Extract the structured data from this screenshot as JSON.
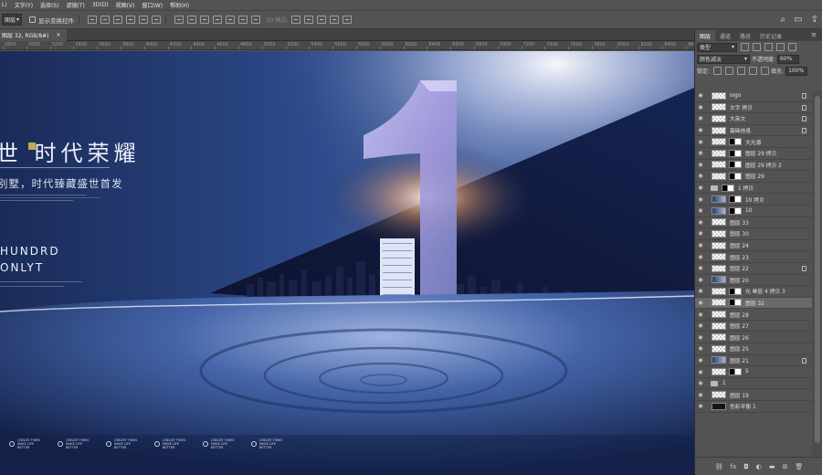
{
  "menubar": [
    "L)",
    "文字(Y)",
    "选择(S)",
    "滤镜(T)",
    "3D(D)",
    "视图(V)",
    "窗口(W)",
    "帮助(H)"
  ],
  "options": {
    "select_value": "图层",
    "show_transform_label": "显示变换控件",
    "mode_label": "3D 模式:"
  },
  "document_tab": {
    "title": "图层 32, RGB/8#)",
    "close": "×"
  },
  "ruler_ticks": [
    "2800",
    "3000",
    "3200",
    "3400",
    "3600",
    "3800",
    "4000",
    "4200",
    "4400",
    "4600",
    "4800",
    "5000",
    "5200",
    "5400",
    "5600",
    "5800",
    "6000",
    "6200",
    "6400",
    "6600",
    "6800",
    "7000",
    "7200",
    "7400",
    "7600",
    "7800",
    "8000",
    "8200",
    "8400",
    "8600",
    "8800"
  ],
  "poster": {
    "slogan": "世  时代荣耀",
    "subline": "别墅，时代臻藏盛世首发",
    "line1": "HUNDRD",
    "line2": "ONLYT",
    "big_number": "1",
    "badge_text": "CREATE TIMES MAKE LIFE BETTER",
    "badge_count": 6
  },
  "panel": {
    "tabs": [
      "图层",
      "通道",
      "路径",
      "历史记录"
    ],
    "kind": "类型",
    "blend_mode": "颜色减淡",
    "opacity_label": "不透明度:",
    "opacity_value": "60%",
    "lock_label": "锁定:",
    "fill_label": "填充:",
    "fill_value": "100%"
  },
  "layers": [
    {
      "name": "logo",
      "thumb": "check",
      "locked": true
    },
    {
      "name": "文字 拷贝",
      "thumb": "check",
      "locked": true
    },
    {
      "name": "大英文",
      "thumb": "check",
      "locked": true
    },
    {
      "name": "基础信息",
      "thumb": "check",
      "locked": true
    },
    {
      "name": "大光源",
      "thumb": "check",
      "mask": true
    },
    {
      "name": "图层 29 拷贝",
      "thumb": "check",
      "mask": true
    },
    {
      "name": "图层 29 拷贝 2",
      "thumb": "check",
      "mask": true
    },
    {
      "name": "图层 29",
      "thumb": "check",
      "mask": true
    },
    {
      "name": "1 拷贝",
      "thumb": "fold",
      "mask": true
    },
    {
      "name": "10 拷贝",
      "thumb": "img",
      "mask": true
    },
    {
      "name": "10",
      "thumb": "img",
      "mask": true
    },
    {
      "name": "图层 33",
      "thumb": "check"
    },
    {
      "name": "图层 30",
      "thumb": "check"
    },
    {
      "name": "图层 24",
      "thumb": "check"
    },
    {
      "name": "图层 23",
      "thumb": "check"
    },
    {
      "name": "图层 22",
      "thumb": "check",
      "locked": true
    },
    {
      "name": "图层 20",
      "thumb": "img"
    },
    {
      "name": "光 晕层 4 拷贝 3",
      "thumb": "check",
      "mask": true
    },
    {
      "name": "图层 32",
      "thumb": "check",
      "mask": true,
      "selected": true
    },
    {
      "name": "图层 28",
      "thumb": "check"
    },
    {
      "name": "图层 27",
      "thumb": "check"
    },
    {
      "name": "图层 26",
      "thumb": "check"
    },
    {
      "name": "图层 25",
      "thumb": "check"
    },
    {
      "name": "图层 21",
      "thumb": "img",
      "locked": true
    },
    {
      "name": "5",
      "thumb": "check",
      "mask": true
    },
    {
      "name": "1",
      "thumb": "fold"
    },
    {
      "name": "图层 19",
      "thumb": "check"
    },
    {
      "name": "色彩平衡 1",
      "thumb": "dark"
    }
  ],
  "footer_icons": [
    "link-icon",
    "fx-icon",
    "mask-icon",
    "adjustment-icon",
    "folder-icon",
    "new-layer-icon",
    "trash-icon"
  ]
}
